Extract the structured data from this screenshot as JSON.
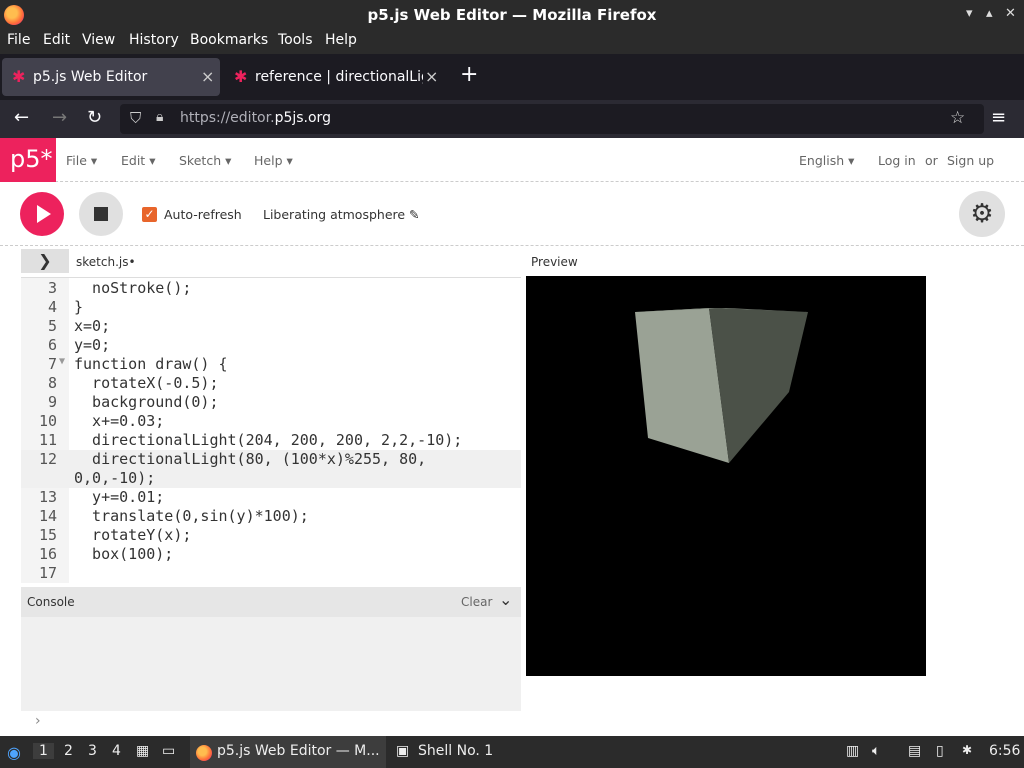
{
  "window": {
    "title": "p5.js Web Editor — Mozilla Firefox"
  },
  "menubar": [
    "File",
    "Edit",
    "View",
    "History",
    "Bookmarks",
    "Tools",
    "Help"
  ],
  "tabs": [
    {
      "label": "p5.js Web Editor",
      "active": true
    },
    {
      "label": "reference | directionalLig",
      "active": false
    }
  ],
  "nav": {
    "url_dim": "https://editor.",
    "url_main": "p5js.org"
  },
  "p5": {
    "logo": "p5*",
    "menu": [
      "File",
      "Edit",
      "Sketch",
      "Help"
    ],
    "language": "English",
    "login": "Log in",
    "or": "or",
    "signup": "Sign up"
  },
  "toolbar": {
    "autorefresh_label": "Auto-refresh",
    "sketch_name": "Liberating atmosphere ✎"
  },
  "editor": {
    "file_tab": "sketch.js•",
    "preview_label": "Preview",
    "lines": [
      {
        "n": "3",
        "code": "  noStroke();"
      },
      {
        "n": "4",
        "code": "}"
      },
      {
        "n": "5",
        "code": "x=0;"
      },
      {
        "n": "6",
        "code": "y=0;"
      },
      {
        "n": "7",
        "code": "function draw() {"
      },
      {
        "n": "8",
        "code": "  rotateX(-0.5);"
      },
      {
        "n": "9",
        "code": "  background(0);"
      },
      {
        "n": "10",
        "code": "  x+=0.03;"
      },
      {
        "n": "11",
        "code": "  directionalLight(204, 200, 200, 2,2,-10);"
      },
      {
        "n": "12",
        "code": "  directionalLight(80, (100*x)%255, 80,"
      },
      {
        "n": "",
        "code": "0,0,-10);"
      },
      {
        "n": "13",
        "code": "  y+=0.01;"
      },
      {
        "n": "14",
        "code": "  translate(0,sin(y)*100);"
      },
      {
        "n": "15",
        "code": "  rotateY(x);"
      },
      {
        "n": "16",
        "code": "  box(100);"
      },
      {
        "n": "17",
        "code": ""
      }
    ]
  },
  "console": {
    "label": "Console",
    "clear": "Clear",
    "prompt": "›"
  },
  "taskbar": {
    "workspaces": [
      "1",
      "2",
      "3",
      "4"
    ],
    "apps": [
      "p5.js Web Editor — M...",
      "Shell No. 1"
    ],
    "clock": "6:56"
  },
  "colors": {
    "accent": "#ed225d",
    "checkbox": "#e8652b"
  }
}
